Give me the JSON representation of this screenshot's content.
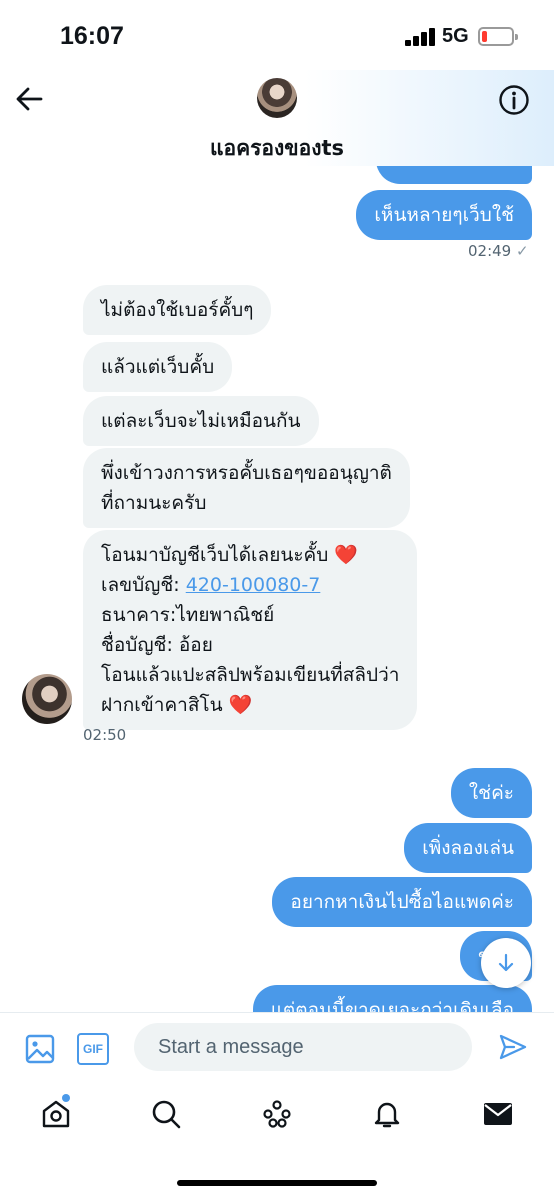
{
  "status_bar": {
    "time": "16:07",
    "network": "5G"
  },
  "header": {
    "name": "แอครองของts"
  },
  "messages": {
    "m0": "เห็นหลายๆเว็บใช้",
    "t0": "02:49",
    "t0_check": "✓",
    "r1": "ไม่ต้องใช้เบอร์คั้บๆ",
    "r2": "แล้วแต่เว็บคั้บ",
    "r3": "แต่ละเว็บจะไม่เหมือนกัน",
    "r4_l1": "พึ่งเข้าวงการหรอคั้บเธอๆขออนุญาติ",
    "r4_l2": "ที่ถามนะครับ",
    "r5_l1": "โอนมาบัญชีเว็บได้เลยนะคั้บ ❤️",
    "r5_l2_label": "เลขบัญชี: ",
    "r5_l2_link": "420-100080-7",
    "r5_l3": "ธนาคาร:ไทยพาณิชย์",
    "r5_l4": "ชื่อบัญชี: อ้อย",
    "r5_l5": "โอนแล้วแปะสลิปพร้อมเขียนที่สลิปว่า",
    "r5_l6": "ฝากเข้าคาสิโน ❤️",
    "t1": "02:50",
    "s1": "ใช่ค่ะ",
    "s2": "เพิ่งลองเล่น",
    "s3": "อยากหาเงินไปซื้อไอแพดค่ะ",
    "s4": "ขาด",
    "s5": "แต่ตอนนี้ขาดเยอะกว่าเดิมเลือ"
  },
  "composer": {
    "placeholder": "Start a message",
    "gif_label": "GIF"
  },
  "icons": [
    "back-arrow-icon",
    "info-icon",
    "image-icon",
    "gif-icon",
    "send-icon",
    "home-icon",
    "search-icon",
    "spaces-icon",
    "bell-icon",
    "mail-icon",
    "arrow-down-icon"
  ],
  "colors": {
    "accent": "#4a99e9",
    "received_bubble": "#eff3f4",
    "battery_low": "#ff3b30"
  }
}
